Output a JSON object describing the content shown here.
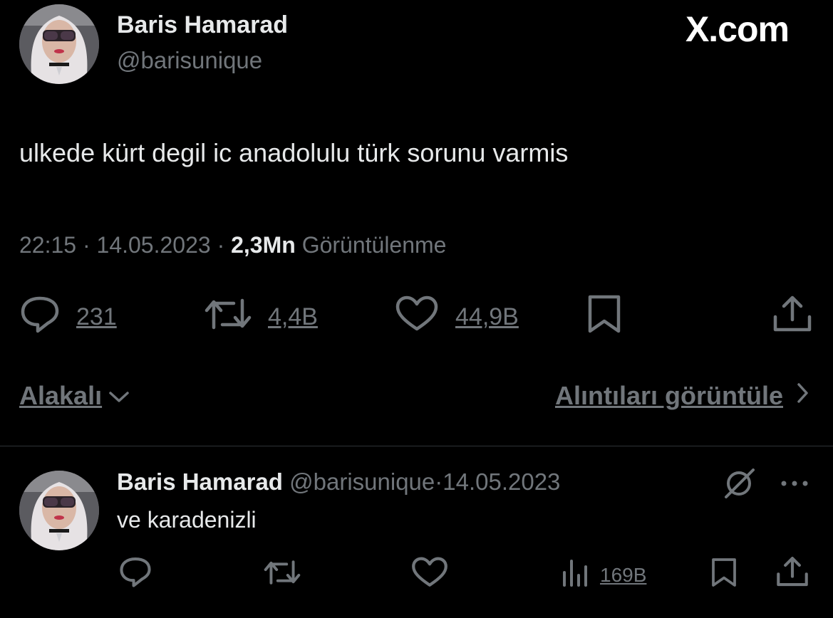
{
  "brand": {
    "label": "X.com"
  },
  "tweet": {
    "author_name": "Baris Hamarad",
    "author_handle": "@barisunique",
    "text": "ulkede kürt degil ic anadolulu türk sorunu varmis",
    "time": "22:15",
    "separator": "·",
    "date": "14.05.2023",
    "views_count": "2,3Mn",
    "views_label": "Görüntülenme",
    "replies": "231",
    "reposts": "4,4B",
    "likes": "44,9B"
  },
  "reply_controls": {
    "sort_label": "Alakalı",
    "quotes_label": "Alıntıları görüntüle"
  },
  "reply": {
    "author_name": "Baris Hamarad",
    "author_handle": "@barisunique",
    "separator": "·",
    "date": "14.05.2023",
    "text": "ve karadenizli",
    "views": "169B"
  },
  "icons": {
    "reply": "comment-icon",
    "repost": "repost-icon",
    "like": "heart-icon",
    "bookmark": "bookmark-icon",
    "share": "share-icon",
    "analytics": "analytics-icon",
    "grok": "grok-icon",
    "more": "more-icon",
    "chevron_down": "chevron-down-icon",
    "chevron_right": "chevron-right-icon"
  },
  "colors": {
    "background": "#000000",
    "text": "#e7e9ea",
    "secondary": "#71767b",
    "divider": "#2f3336"
  }
}
